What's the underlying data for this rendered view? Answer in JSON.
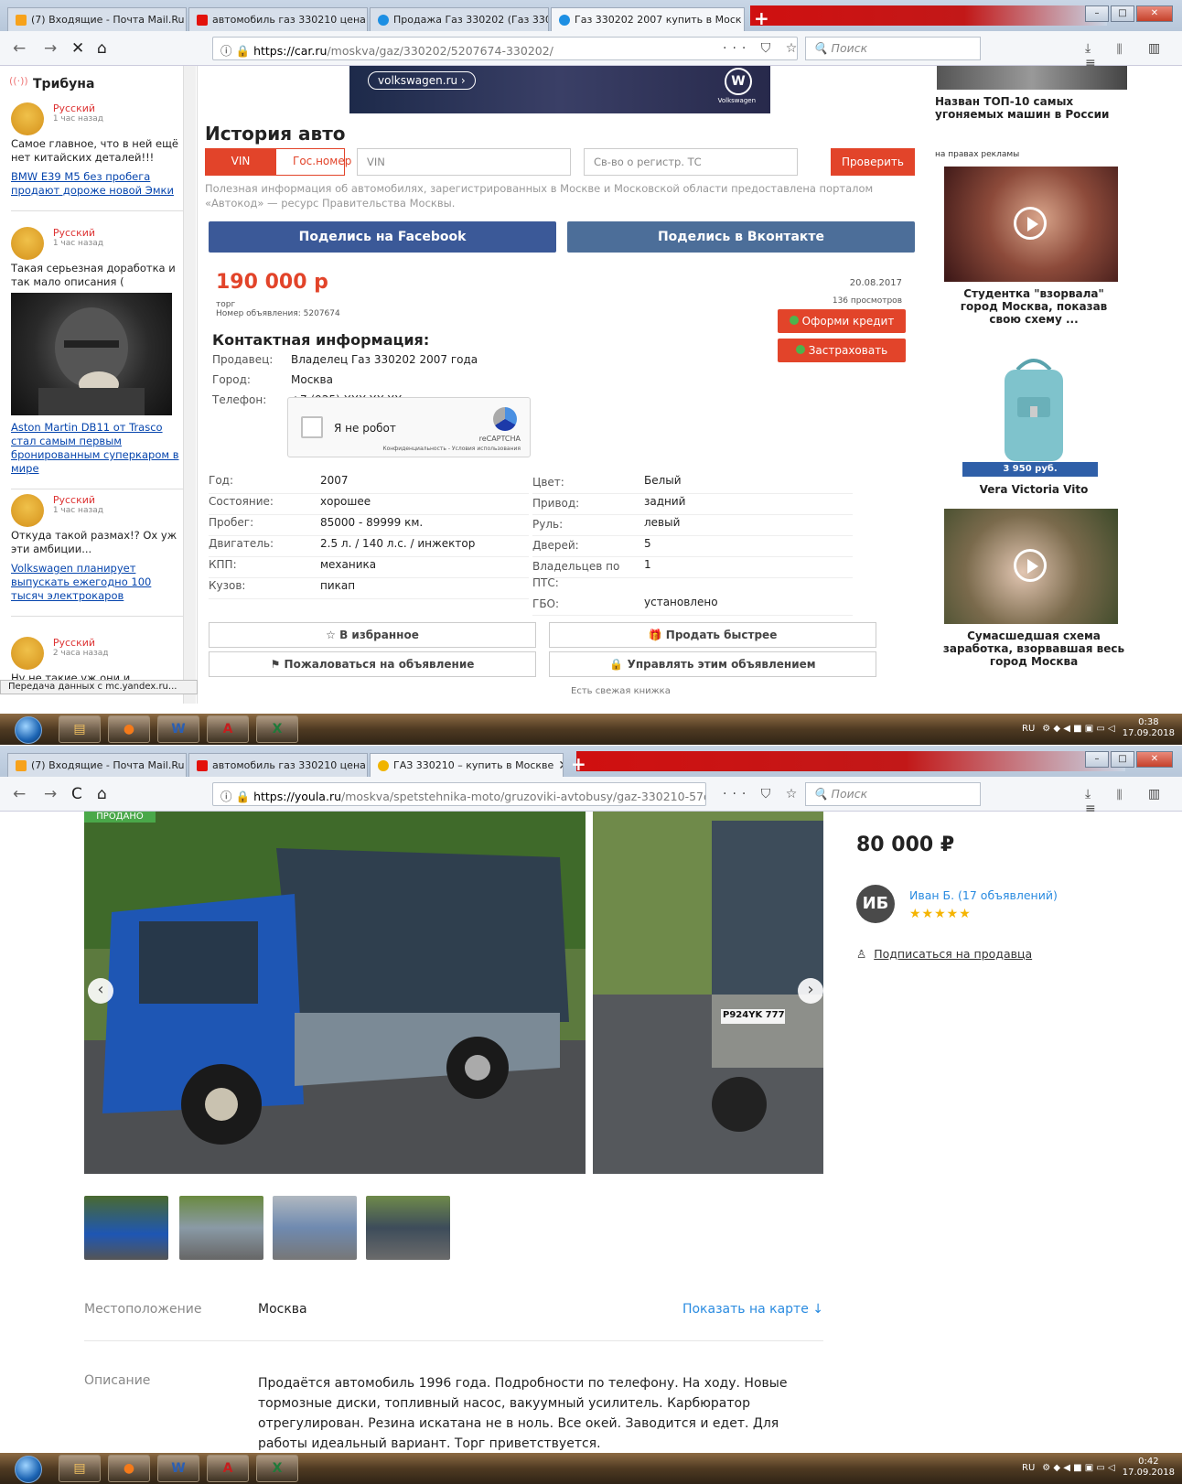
{
  "screen1": {
    "tabs": [
      {
        "label": "(7) Входящие - Почта Mail.Ru",
        "color": "#f7a21b"
      },
      {
        "label": "автомобиль газ 330210 цена -",
        "color": "#e3120b"
      },
      {
        "label": "Продажа Газ 330202 (Газ 3302",
        "color": "#1d8fe3"
      },
      {
        "label": "Газ 330202 2007 купить в Моск",
        "color": "#1d8fe3"
      }
    ],
    "url_domain": "https://car.ru",
    "url_path": "/moskva/gaz/330202/5207674-330202/",
    "search_placeholder": "Поиск",
    "sidebar": {
      "title": "Трибуна",
      "posts": [
        {
          "author": "Русский",
          "time": "1 час назад",
          "text": "Самое главное, что в ней ещё нет китайских деталей!!!",
          "link": "BMW E39 M5 без пробега продают дороже новой Эмки"
        },
        {
          "author": "Русский",
          "time": "1 час назад",
          "text": "Такая серьезная доработка и так мало описания (",
          "link": "Aston Martin DB11 от Trasco стал самым первым бронированным суперкаром в мире"
        },
        {
          "author": "Русский",
          "time": "1 час назад",
          "text": "Откуда такой размах!? Ох уж эти амбиции...",
          "link": "Volkswagen планирует выпускать ежегодно 100 тысяч электрокаров"
        },
        {
          "author": "Русский",
          "time": "2 часа назад",
          "text": "Ну не такие уж они и",
          "link": ""
        }
      ],
      "status": "Передача данных с mc.yandex.ru..."
    },
    "banner": {
      "pill": "volkswagen.ru ›",
      "brand": "Volkswagen",
      "logo": "W"
    },
    "history": {
      "title": "История авто",
      "vin_tab": "VIN",
      "plate_tab": "Гос.номер",
      "vin_placeholder": "VIN",
      "reg_placeholder": "Св-во о регистр. ТС",
      "check_button": "Проверить",
      "note": "Полезная информация об автомобилях, зарегистрированных в Москве и Московской области предоставлена порталом «Автокод» — ресурс Правительства Москвы."
    },
    "share": {
      "facebook": "Поделись на Facebook",
      "vk": "Поделись в Вконтакте"
    },
    "listing": {
      "price": "190 000 р",
      "torg": "торг",
      "ad_number": "Номер объявления: 5207674",
      "date": "20.08.2017",
      "views": "136 просмотров",
      "credit_button": "Оформи кредит",
      "insure_button": "Застраховать"
    },
    "contact": {
      "title": "Контактная информация:",
      "seller_label": "Продавец:",
      "seller": "Владелец Газ 330202 2007 года",
      "city_label": "Город:",
      "city": "Москва",
      "phone_label": "Телефон:",
      "phone": "+7 (925) XXX-XX-XX"
    },
    "captcha": {
      "label": "Я не робот",
      "brand": "reCAPTCHA",
      "privacy": "Конфиденциальность - Условия использования"
    },
    "specs_left": [
      {
        "k": "Год:",
        "v": "2007"
      },
      {
        "k": "Состояние:",
        "v": "хорошее"
      },
      {
        "k": "Пробег:",
        "v": "85000 - 89999 км."
      },
      {
        "k": "Двигатель:",
        "v": "2.5 л. / 140 л.с. / инжектор"
      },
      {
        "k": "КПП:",
        "v": "механика"
      },
      {
        "k": "Кузов:",
        "v": "пикап"
      }
    ],
    "specs_right": [
      {
        "k": "Цвет:",
        "v": "Белый"
      },
      {
        "k": "Привод:",
        "v": "задний"
      },
      {
        "k": "Руль:",
        "v": "левый"
      },
      {
        "k": "Дверей:",
        "v": "5"
      },
      {
        "k": "Владельцев по ПТС:",
        "v": "1"
      },
      {
        "k": "ГБО:",
        "v": "установлено"
      }
    ],
    "actions": {
      "favorite": "☆ В избранное",
      "sell_faster": "Продать быстрее",
      "report": "Пожаловаться на объявление",
      "manage": "Управлять этим объявлением"
    },
    "cut_text": "Есть свежая книжка",
    "right_col": {
      "headline": "Назван ТОП-10 самых угоняемых машин в России",
      "ad_label": "на правах рекламы",
      "ad1": "Студентка \"взорвала\" город Москва, показав свою схему ...",
      "bag_price": "3 950 руб.",
      "bag_brand": "Vera Victoria Vito",
      "ad2": "Сумасшедшая схема заработка, взорвавшая весь город Москва"
    },
    "clock": {
      "time": "0:38",
      "date": "17.09.2018",
      "lang": "RU"
    }
  },
  "screen2": {
    "tabs": [
      {
        "label": "(7) Входящие - Почта Mail.Ru",
        "color": "#f7a21b"
      },
      {
        "label": "автомобиль газ 330210 цена -",
        "color": "#e3120b"
      },
      {
        "label": "ГАЗ 330210 – купить в Москве",
        "color": "#f0b400"
      }
    ],
    "url_domain": "https://youla.ru",
    "url_path": "/moskva/spetstehnika-moto/gruzoviki-avtobusy/gaz-330210-57da792",
    "search_placeholder": "Поиск",
    "sold_badge": "ПРОДАНО",
    "plate": "P924YK 777",
    "price": "80 000 ₽",
    "seller_initials": "ИБ",
    "seller_name": "Иван Б. (17 объявлений)",
    "rating": "★★★★★",
    "subscribe": "Подписаться на продавца",
    "location_label": "Местоположение",
    "location": "Москва",
    "map_link": "Показать на карте ↓",
    "description_label": "Описание",
    "description": "Продаётся автомобиль 1996 года. Подробности по телефону. На ходу. Новые тормозные диски, топливный насос, вакуумный усилитель. Карбюратор отрегулирован. Резина искатана не в ноль. Все окей. Заводится и едет. Для работы идеальный вариант. Торг приветствуется.",
    "clock": {
      "time": "0:42",
      "date": "17.09.2018",
      "lang": "RU"
    }
  },
  "icons": {
    "back": "←",
    "forward": "→",
    "stop": "✕",
    "reload": "C",
    "home": "⌂",
    "page_actions": "··· ⛉ ☆",
    "library": "⤓ ⫴ ▥ ≡"
  }
}
